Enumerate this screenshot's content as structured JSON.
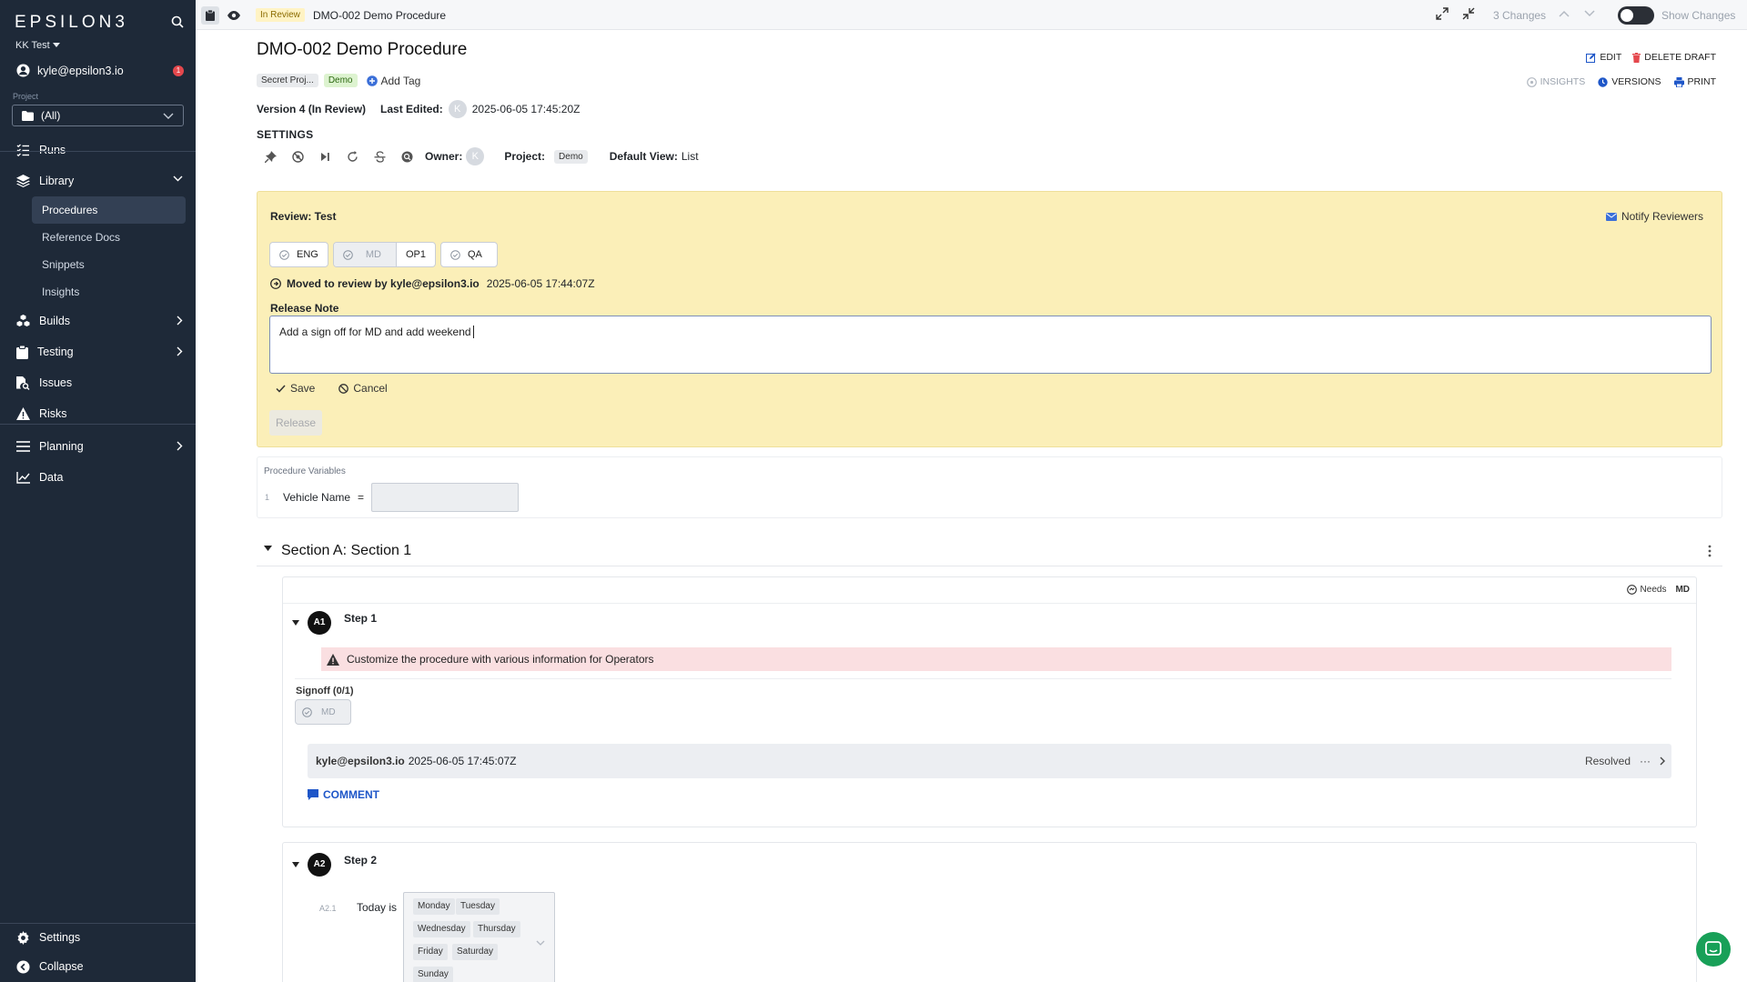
{
  "sidebar": {
    "logo": "EPSILON3",
    "workspace": "KK Test",
    "user_email": "kyle@epsilon3.io",
    "user_badge": "1",
    "project_label": "Project",
    "project_value": "(All)",
    "nav": {
      "runs": "Runs",
      "library": "Library",
      "procedures": "Procedures",
      "reference_docs": "Reference Docs",
      "snippets": "Snippets",
      "insights": "Insights",
      "builds": "Builds",
      "testing": "Testing",
      "issues": "Issues",
      "risks": "Risks",
      "planning": "Planning",
      "data": "Data"
    },
    "settings": "Settings",
    "collapse": "Collapse"
  },
  "topbar": {
    "status": "In Review",
    "title": "DMO-002 Demo Procedure",
    "changes": "3 Changes",
    "show_changes": "Show Changes"
  },
  "doc": {
    "title": "DMO-002 Demo Procedure",
    "tags": [
      "Secret Proj...",
      "Demo"
    ],
    "add_tag": "Add Tag",
    "version": "Version 4 (In Review)",
    "last_edited_label": "Last Edited:",
    "avatar_initial": "K",
    "last_edited": "2025-06-05 17:45:20Z",
    "settings_heading": "SETTINGS",
    "owner_label": "Owner:",
    "project_label": "Project:",
    "project_tag": "Demo",
    "default_view_label": "Default View:",
    "default_view": "List",
    "actions": {
      "edit": "EDIT",
      "delete_draft": "DELETE DRAFT",
      "insights": "INSIGHTS",
      "versions": "VERSIONS",
      "print": "PRINT"
    }
  },
  "review": {
    "title": "Review: Test",
    "notify": "Notify Reviewers",
    "chips": {
      "eng": "ENG",
      "md": "MD",
      "op1": "OP1",
      "qa": "QA"
    },
    "moved": "Moved to review by kyle@epsilon3.io",
    "moved_time": "2025-06-05 17:44:07Z",
    "note_label": "Release Note",
    "note_value": "Add a sign off for MD and add weekend",
    "save": "Save",
    "cancel": "Cancel",
    "release": "Release"
  },
  "variables": {
    "title": "Procedure Variables",
    "rows": [
      {
        "index": "1",
        "name": "Vehicle Name",
        "eq": "="
      }
    ]
  },
  "section": {
    "title": "Section A: Section 1"
  },
  "step1": {
    "needs": "Needs",
    "needs_role": "MD",
    "num": "A1",
    "title": "Step 1",
    "warning": "Customize the procedure with various information for Operators",
    "signoff_label": "Signoff (0/1)",
    "signoff_role": "MD",
    "comment_user": "kyle@epsilon3.io",
    "comment_time": "2025-06-05 17:45:07Z",
    "comment_status": "Resolved",
    "comment_more": "···",
    "comment_button": "COMMENT"
  },
  "step2": {
    "num": "A2",
    "title": "Step 2",
    "sub_index": "A2.1",
    "field_label": "Today is",
    "days": [
      "Monday",
      "Tuesday",
      "Wednesday",
      "Thursday",
      "Friday",
      "Saturday",
      "Sunday"
    ]
  },
  "colors": {
    "sidebar_bg": "#1e2938",
    "review_bg": "#fbefb8",
    "warning_bg": "#fadfe1",
    "accent_blue": "#1e56c8",
    "demo_tag": "#ddf3d0",
    "chat_green": "#18a058"
  }
}
